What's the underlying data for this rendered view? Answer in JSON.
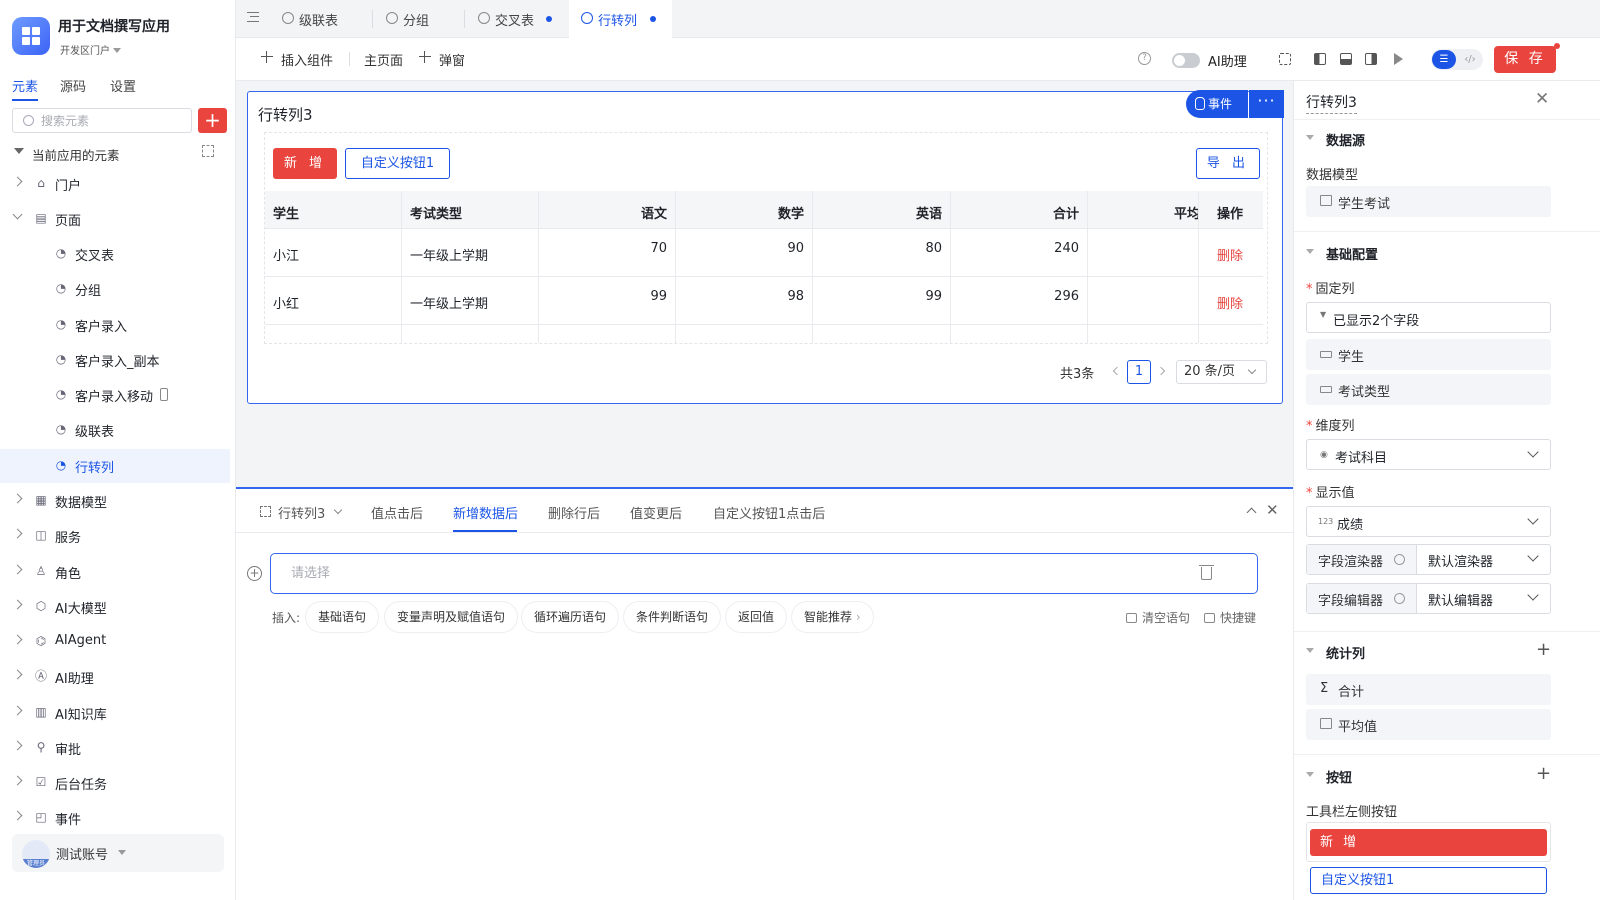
{
  "app": {
    "title": "用于文档撰写应用",
    "subtitle": "开发区门户"
  },
  "left_tabs": [
    "元素",
    "源码",
    "设置"
  ],
  "search": {
    "placeholder": "搜索元素"
  },
  "tree": {
    "header": "当前应用的元素",
    "items": [
      {
        "label": "门户",
        "icon": "home-icon"
      },
      {
        "label": "页面",
        "icon": "pages-icon"
      },
      {
        "label": "交叉表",
        "icon": "page-icon"
      },
      {
        "label": "分组",
        "icon": "page-icon"
      },
      {
        "label": "客户录入",
        "icon": "page-icon"
      },
      {
        "label": "客户录入_副本",
        "icon": "page-icon"
      },
      {
        "label": "客户录入移动",
        "icon": "page-icon"
      },
      {
        "label": "级联表",
        "icon": "page-icon"
      },
      {
        "label": "行转列",
        "icon": "page-icon"
      },
      {
        "label": "数据模型",
        "icon": "table-icon"
      },
      {
        "label": "服务",
        "icon": "service-icon"
      },
      {
        "label": "角色",
        "icon": "role-icon"
      },
      {
        "label": "AI大模型",
        "icon": "ai-model-icon"
      },
      {
        "label": "AIAgent",
        "icon": "robot-icon"
      },
      {
        "label": "AI助理",
        "icon": "ai-assistant-icon"
      },
      {
        "label": "AI知识库",
        "icon": "book-icon"
      },
      {
        "label": "审批",
        "icon": "stamp-icon"
      },
      {
        "label": "后台任务",
        "icon": "task-icon"
      },
      {
        "label": "事件",
        "icon": "event-icon"
      }
    ]
  },
  "user": {
    "name": "测试账号",
    "badge": "管理员"
  },
  "page_tabs": [
    {
      "label": "级联表"
    },
    {
      "label": "分组"
    },
    {
      "label": "交叉表"
    },
    {
      "label": "行转列"
    }
  ],
  "toolbar": {
    "insert": "插入组件",
    "main_page": "主页面",
    "popup": "弹窗",
    "ai_assistant": "AI助理",
    "save": "保 存"
  },
  "component": {
    "title": "行转列3",
    "event_button": "事件",
    "buttons": {
      "new": "新 增",
      "custom": "自定义按钮1",
      "export": "导 出"
    },
    "table": {
      "headers": [
        "学生",
        "考试类型",
        "语文",
        "数学",
        "英语",
        "合计",
        "平均",
        "操作"
      ],
      "rows": [
        [
          "小江",
          "一年级上学期",
          "70",
          "90",
          "80",
          "240",
          "",
          "删除"
        ],
        [
          "小红",
          "一年级上学期",
          "99",
          "98",
          "99",
          "296",
          "",
          "删除"
        ]
      ]
    },
    "pager": {
      "total": "共3条",
      "page": "1",
      "size": "20 条/页"
    }
  },
  "event_panel": {
    "component": "行转列3",
    "tabs": [
      "值点击后",
      "新增数据后",
      "删除行后",
      "值变更后",
      "自定义按钮1点击后"
    ],
    "active_tab": "新增数据后",
    "select_placeholder": "请选择",
    "insert_label": "插入:",
    "chips": [
      "基础语句",
      "变量声明及赋值语句",
      "循环遍历语句",
      "条件判断语句",
      "返回值",
      "智能推荐"
    ],
    "actions": {
      "clear": "清空语句",
      "shortcut": "快捷键"
    }
  },
  "props": {
    "title": "行转列3",
    "datasource": {
      "section": "数据源",
      "model_label": "数据模型",
      "model": "学生考试"
    },
    "basic": {
      "section": "基础配置",
      "fixed_label": "固定列",
      "fixed_select": "已显示2个字段",
      "fixed_fields": [
        "学生",
        "考试类型"
      ],
      "dim_label": "维度列",
      "dim_value": "考试科目",
      "show_label": "显示值",
      "show_value": "成绩",
      "renderer_label": "字段渲染器",
      "renderer_value": "默认渲染器",
      "editor_label": "字段编辑器",
      "editor_value": "默认编辑器"
    },
    "stats": {
      "section": "统计列",
      "items": [
        "合计",
        "平均值"
      ]
    },
    "buttons": {
      "section": "按钮",
      "left_label": "工具栏左侧按钮",
      "new": "新 增",
      "custom": "自定义按钮1"
    }
  },
  "colors": {
    "primary": "#1c55e6",
    "danger": "#e9453e"
  }
}
